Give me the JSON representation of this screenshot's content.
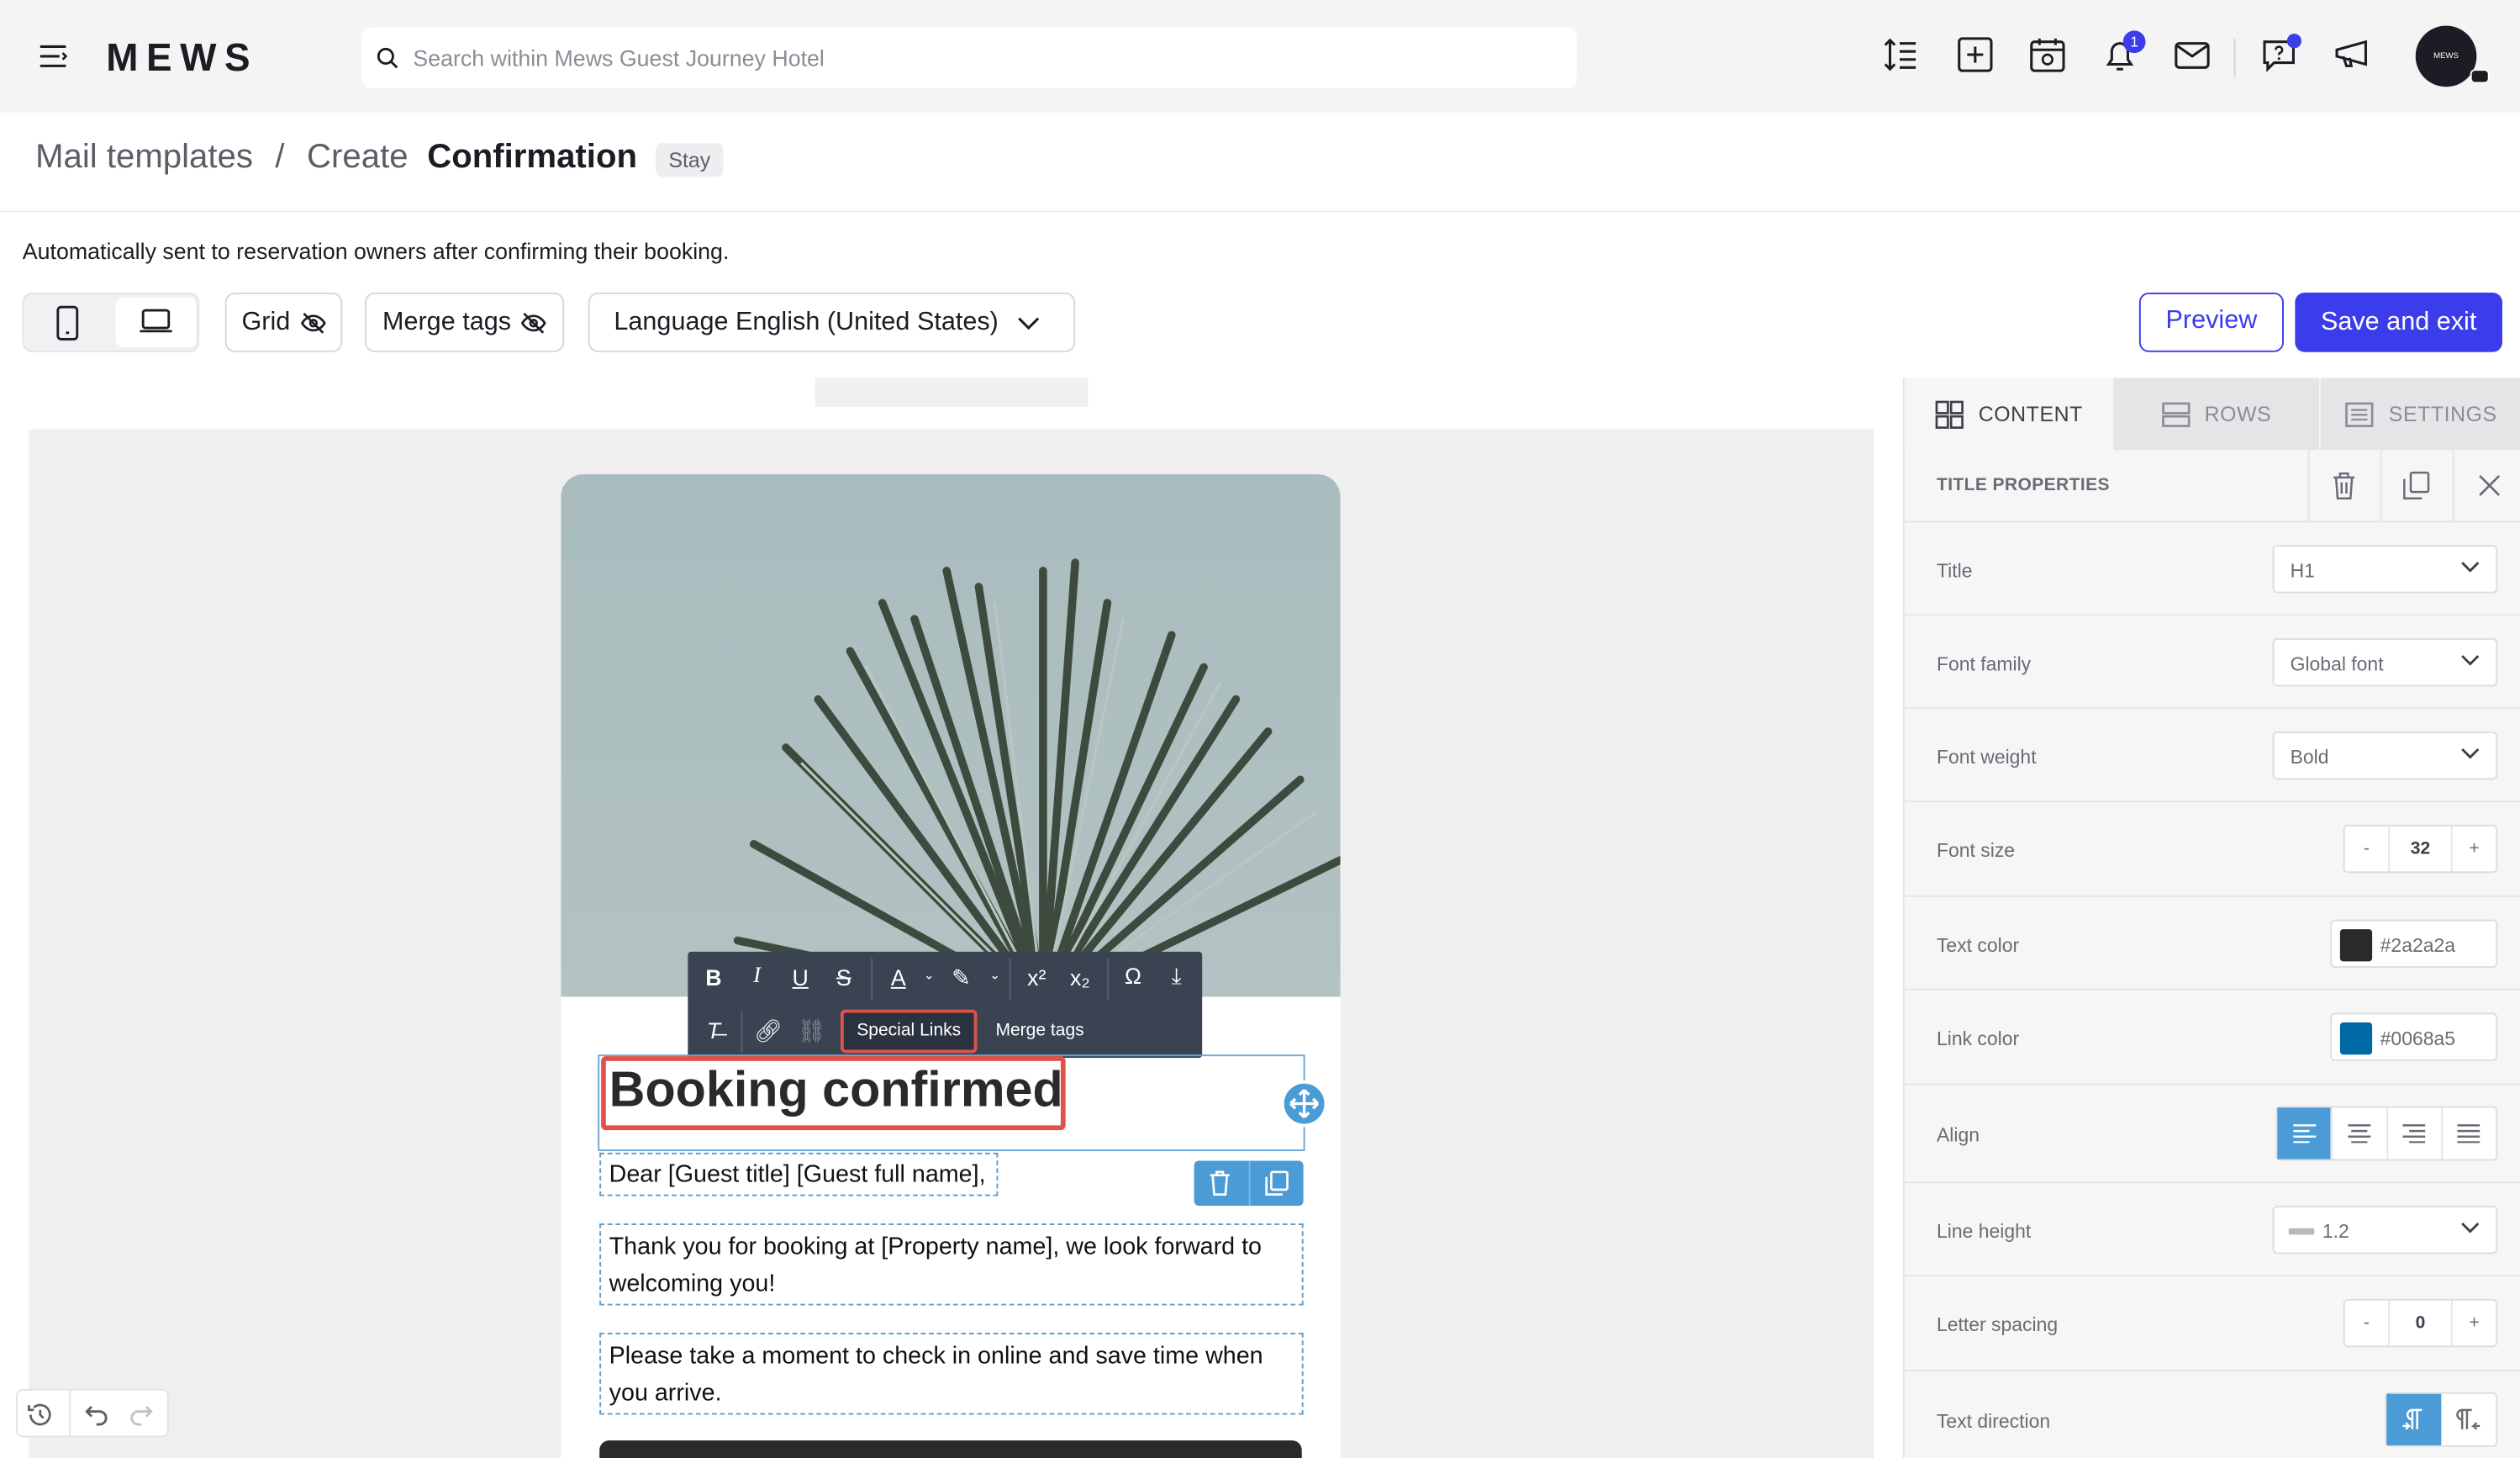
{
  "header": {
    "logo": "MEWS",
    "search_placeholder": "Search within Mews Guest Journey Hotel",
    "notification_count": "1",
    "avatar_text": "MEWS"
  },
  "breadcrumb": {
    "level1": "Mail templates",
    "separator": "/",
    "level2": "Create",
    "current": "Confirmation",
    "tag": "Stay"
  },
  "description": "Automatically sent to reservation owners after confirming their booking.",
  "toolbar": {
    "grid_label": "Grid",
    "merge_tags_label": "Merge tags",
    "language_label": "Language English (United States)",
    "preview_label": "Preview",
    "save_label": "Save and exit"
  },
  "editor": {
    "rte_special_links": "Special Links",
    "rte_merge_tags": "Merge tags",
    "title": "Booking confirmed",
    "paragraphs": [
      "Dear [Guest title] [Guest full name],",
      "Thank you for booking at [Property name], we look forward to welcoming you!",
      "Please take a moment to check in online and save time when you arrive."
    ]
  },
  "panel": {
    "tabs": [
      "CONTENT",
      "ROWS",
      "SETTINGS"
    ],
    "section_title": "TITLE PROPERTIES",
    "rows": [
      {
        "label": "Title",
        "value": "H1"
      },
      {
        "label": "Font family",
        "value": "Global font"
      },
      {
        "label": "Font weight",
        "value": "Bold"
      },
      {
        "label": "Font size",
        "value": "32",
        "minus": "-",
        "plus": "+"
      },
      {
        "label": "Text color",
        "value": "#2a2a2a"
      },
      {
        "label": "Link color",
        "value": "#0068a5"
      },
      {
        "label": "Align"
      },
      {
        "label": "Line height",
        "value": "1.2"
      },
      {
        "label": "Letter spacing",
        "value": "0",
        "minus": "-",
        "plus": "+"
      },
      {
        "label": "Text direction"
      }
    ]
  },
  "colors": {
    "accent": "#3b3ded",
    "highlight": "#e0534d",
    "selection_blue": "#4a9bd6",
    "text_color": "#2a2a2a",
    "link_color": "#0068a5"
  }
}
